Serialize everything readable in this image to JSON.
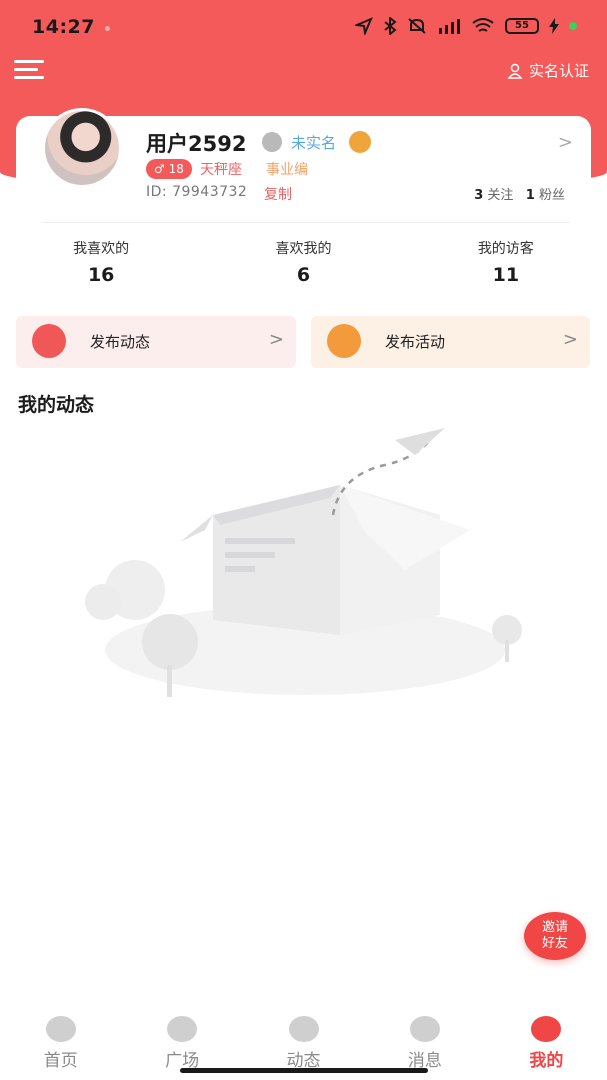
{
  "status_bar": {
    "time": "14:27",
    "battery": "55"
  },
  "top_nav": {
    "verify_label": "实名认证"
  },
  "profile": {
    "username": "用户2592",
    "verify_status": "未实名",
    "age_badge": "18",
    "zodiac": "天秤座",
    "job": "事业编",
    "id_text": "ID: 79943732",
    "copy_label": "复制",
    "following_count": "3",
    "following_label": "关注",
    "fans_count": "1",
    "fans_label": "粉丝"
  },
  "stats": [
    {
      "label": "我喜欢的",
      "value": "16"
    },
    {
      "label": "喜欢我的",
      "value": "6"
    },
    {
      "label": "我的访客",
      "value": "11"
    }
  ],
  "actions": {
    "post": {
      "label": "发布动态"
    },
    "event": {
      "label": "发布活动"
    }
  },
  "section": {
    "title": "我的动态"
  },
  "invite": {
    "line1": "邀请",
    "line2": "好友"
  },
  "bottom_nav": [
    {
      "label": "首页"
    },
    {
      "label": "广场"
    },
    {
      "label": "动态"
    },
    {
      "label": "消息"
    },
    {
      "label": "我的"
    }
  ],
  "colors": {
    "primary": "#f45a5a",
    "accent_orange": "#f39a3c",
    "verify_blue": "#5aa7df"
  }
}
